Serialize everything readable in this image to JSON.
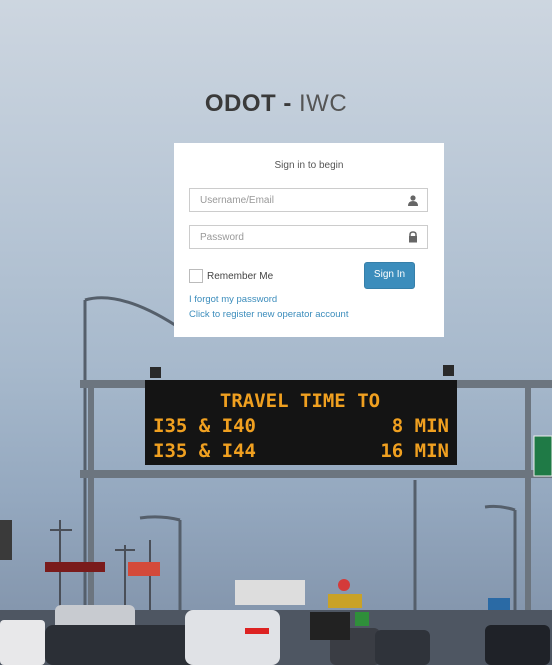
{
  "brand": {
    "bold": "ODOT -",
    "light": "IWC"
  },
  "login": {
    "header": "Sign in to begin",
    "username_placeholder": "Username/Email",
    "password_placeholder": "Password",
    "remember_label": "Remember Me",
    "signin_label": "Sign In",
    "forgot_link": "I forgot my password",
    "register_link": "Click to register new operator account"
  },
  "background_sign": {
    "line1": "TRAVEL TIME TO",
    "line2_left": "I35 & I40",
    "line2_right": "8 MIN",
    "line3_left": "I35 & I44",
    "line3_right": "16 MIN"
  },
  "colors": {
    "accent": "#3c8dbc",
    "sign_text": "#f0a020"
  }
}
